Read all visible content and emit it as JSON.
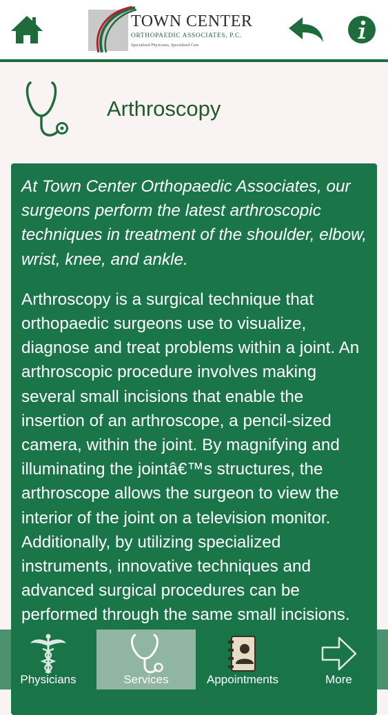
{
  "header": {
    "logo": {
      "title": "TOWN CENTER",
      "subtitle": "ORTHOPAEDIC ASSOCIATES, P.C.",
      "tagline": "Specialized Physicians, Specialized Care"
    },
    "home_icon": "home-icon",
    "back_icon": "back-arrow-icon",
    "info_icon": "info-icon"
  },
  "page": {
    "title": "Arthroscopy",
    "title_icon": "stethoscope-icon"
  },
  "content": {
    "intro": "At Town Center Orthopaedic Associates, our surgeons perform the latest arthroscopic techniques in treatment of the shoulder, elbow, wrist, knee, and ankle.",
    "body": "Arthroscopy is a surgical technique that orthopaedic surgeons use to visualize, diagnose and treat problems within a joint. An arthroscopic procedure involves making several small incisions that enable the insertion of an arthroscope, a pencil-sized camera, within the joint. By magnifying and illuminating the jointâ€™s structures, the arthroscope allows the surgeon to view the interior of the joint on a television monitor. Additionally, by utilizing specialized instruments, innovative techniques and advanced surgical procedures can be performed through the same small incisions."
  },
  "tabs": [
    {
      "label": "Physicians",
      "icon": "caduceus-icon",
      "selected": false
    },
    {
      "label": "Services",
      "icon": "stethoscope-icon",
      "selected": true
    },
    {
      "label": "Appointments",
      "icon": "address-book-icon",
      "selected": false
    },
    {
      "label": "More",
      "icon": "arrow-right-icon",
      "selected": false
    }
  ],
  "colors": {
    "brand_green": "#1a7548",
    "header_green": "#1e6b3c",
    "title_green": "#1f5a2a",
    "background": "#faf3f3"
  }
}
